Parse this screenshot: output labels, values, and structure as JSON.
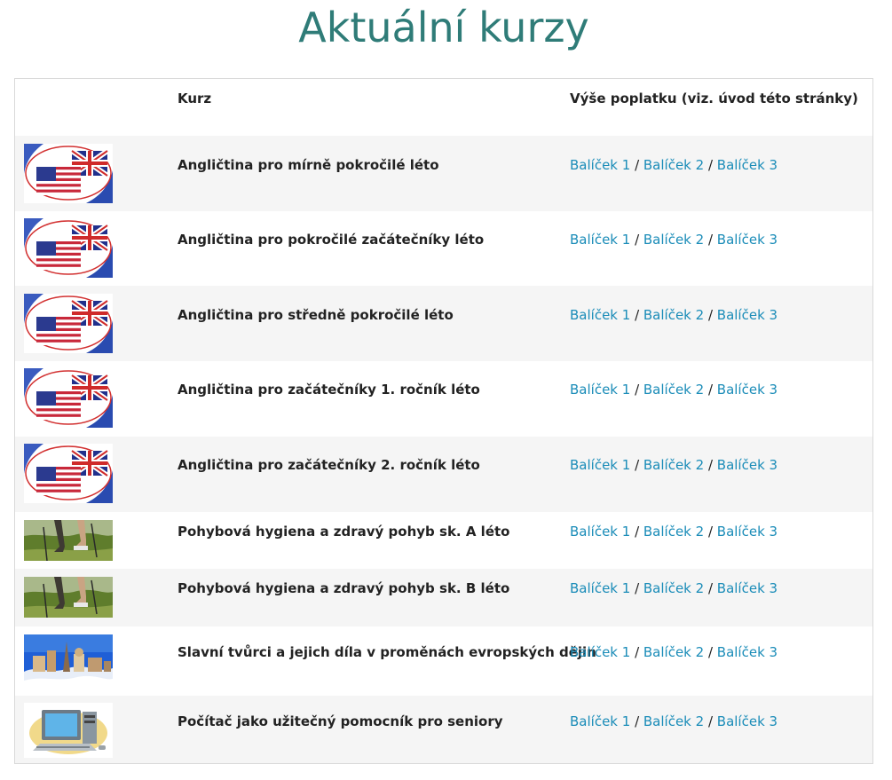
{
  "page": {
    "title": "Aktuální kurzy"
  },
  "table": {
    "headers": {
      "course": "Kurz",
      "fee": "Výše poplatku (viz. úvod této stránky)"
    },
    "separator": " / ",
    "rows": [
      {
        "course": "Angličtina pro mírně pokročilé léto",
        "image": "uk-us-flags-image",
        "links": [
          "Balíček 1",
          "Balíček 2",
          "Balíček 3"
        ]
      },
      {
        "course": "Angličtina pro pokročilé začátečníky léto",
        "image": "uk-us-flags-image",
        "links": [
          "Balíček 1",
          "Balíček 2",
          "Balíček 3"
        ]
      },
      {
        "course": "Angličtina pro středně pokročilé léto",
        "image": "uk-us-flags-image",
        "links": [
          "Balíček 1",
          "Balíček 2",
          "Balíček 3"
        ]
      },
      {
        "course": "Angličtina pro začátečníky 1. ročník léto",
        "image": "uk-us-flags-image",
        "links": [
          "Balíček 1",
          "Balíček 2",
          "Balíček 3"
        ]
      },
      {
        "course": "Angličtina pro začátečníky 2. ročník léto",
        "image": "uk-us-flags-image",
        "links": [
          "Balíček 1",
          "Balíček 2",
          "Balíček 3"
        ]
      },
      {
        "course": "Pohybová hygiena a zdravý pohyb sk. A léto",
        "image": "nordic-walking-image",
        "links": [
          "Balíček 1",
          "Balíček 2",
          "Balíček 3"
        ]
      },
      {
        "course": "Pohybová hygiena a zdravý pohyb sk. B léto",
        "image": "nordic-walking-image",
        "links": [
          "Balíček 1",
          "Balíček 2",
          "Balíček 3"
        ]
      },
      {
        "course": "Slavní tvůrci a jejich díla v proměnách evropských dějin",
        "image": "european-landmarks-image",
        "links": [
          "Balíček 1",
          "Balíček 2",
          "Balíček 3"
        ]
      },
      {
        "course": "Počítač jako užitečný pomocník pro seniory",
        "image": "computer-image",
        "links": [
          "Balíček 1",
          "Balíček 2",
          "Balíček 3"
        ]
      }
    ]
  },
  "colors": {
    "title": "#2f7c78",
    "link": "#1a8cb8",
    "row_alt": "#f5f5f5",
    "border": "#d9d9d9"
  }
}
